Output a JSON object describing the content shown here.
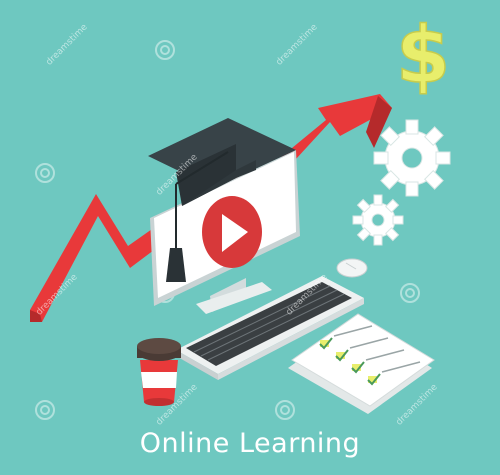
{
  "caption": "Online Learning",
  "watermark": "dreamstime",
  "icons": [
    "dollar-sign-icon",
    "gears-icon",
    "growth-arrow-icon",
    "graduation-cap-icon",
    "play-icon",
    "monitor-icon",
    "keyboard-icon",
    "mouse-icon",
    "coffee-cup-icon",
    "checklist-icon"
  ],
  "colors": {
    "background": "#6ec8c0",
    "arrow": "#e8393a",
    "cap": "#384348",
    "dollar": "#e8ee6c",
    "gear": "#ffffff",
    "screen": "#ffffff",
    "play": "#d7393a"
  }
}
